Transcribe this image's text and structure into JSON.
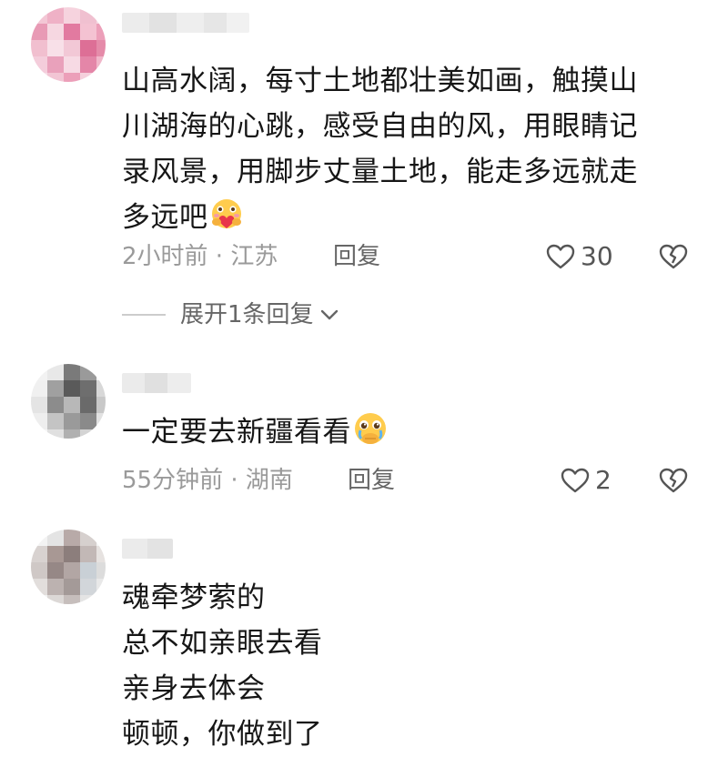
{
  "comments": [
    {
      "text": "山高水阔，每寸土地都壮美如画，触摸山川湖海的心跳，感受自由的风，用眼睛记录风景，用脚步丈量土地，能走多远就走多远吧",
      "lines": [
        "山高水阔，每寸土地都壮美如画，触摸山",
        "川湖海的心跳，感受自由的风，用眼睛记",
        "录风景，用脚步丈量土地，能走多远就走",
        "多远吧"
      ],
      "emoji": "hugging-heart-emoji",
      "time_location": "2小时前 · 江苏",
      "reply_label": "回复",
      "like_count": "30",
      "expand_label": "展开1条回复"
    },
    {
      "text": "一定要去新疆看看",
      "lines": [
        "一定要去新疆看看"
      ],
      "emoji": "pleading-face-emoji",
      "time_location": "55分钟前 · 湖南",
      "reply_label": "回复",
      "like_count": "2"
    },
    {
      "text": "魂牵梦萦的\n总不如亲眼去看\n亲身去体会\n顿顿，你做到了",
      "lines": [
        "魂牵梦萦的",
        "总不如亲眼去看",
        "亲身去体会",
        "顿顿，你做到了"
      ]
    }
  ],
  "icons": {
    "like": "heart-outline-icon",
    "dislike": "broken-heart-icon",
    "expand": "chevron-down-icon"
  },
  "colors": {
    "text": "#161616",
    "meta": "#9a9a9a",
    "reply": "#666666"
  }
}
